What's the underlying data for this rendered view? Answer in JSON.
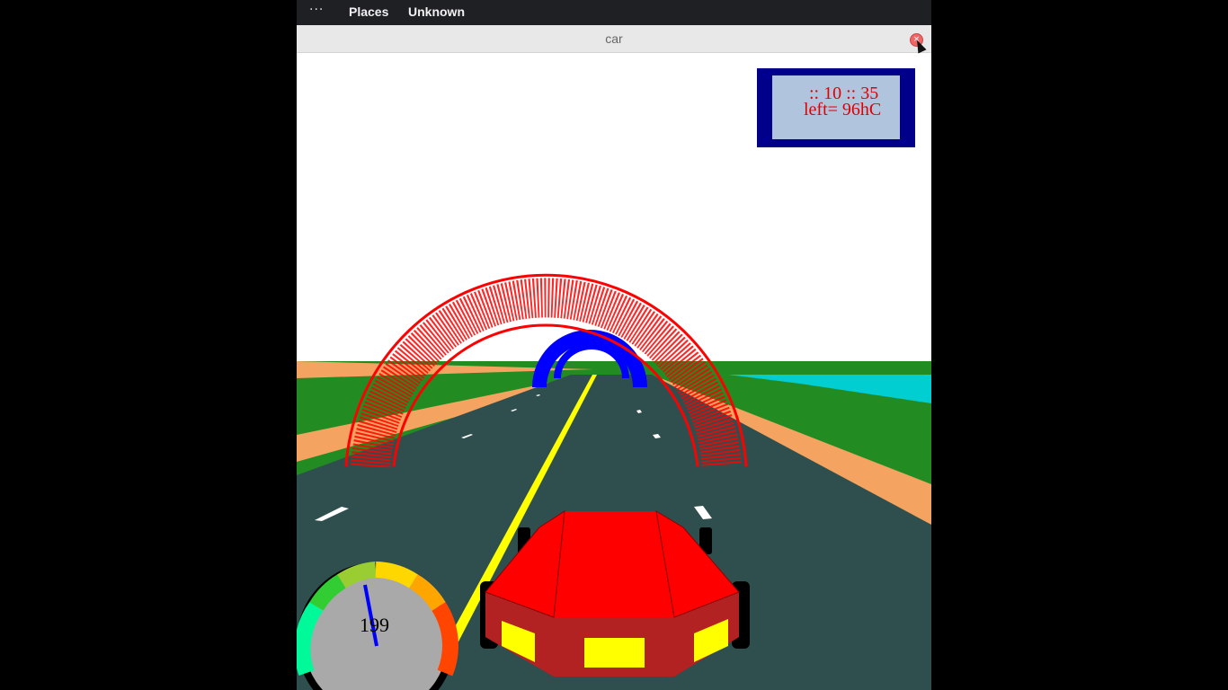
{
  "topbar": {
    "activities": "···",
    "places": "Places",
    "app_menu": "Unknown"
  },
  "window": {
    "title": "car",
    "close_symbol": "×"
  },
  "hud": {
    "time": ":: 10 :: 35",
    "left": "left= 96hC"
  },
  "speedometer": {
    "value": "199"
  },
  "colors": {
    "sky": "#ffffff",
    "road": "#2f4f4f",
    "grass": "#228b22",
    "sand": "#f4a460",
    "water": "#00ced1",
    "arch_near": "#ff0000",
    "arch_far": "#0000ff",
    "center_line": "#ffff00",
    "car_body": "#ff0000",
    "car_lower": "#b22222",
    "car_lights": "#ffff00",
    "hud_frame": "#00008b",
    "hud_panel": "#b0c4de",
    "hud_text": "#e00000"
  }
}
